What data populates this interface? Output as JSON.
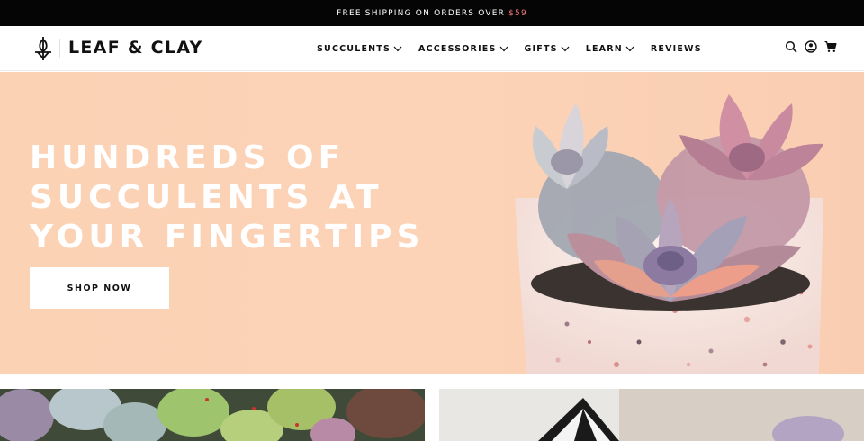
{
  "announcement": {
    "text": "FREE SHIPPING ON ORDERS OVER",
    "amount": "$59",
    "amount_color": "#f27777"
  },
  "brand": {
    "name": "LEAF & CLAY",
    "logo_icon": "plant-sprout-icon"
  },
  "nav": {
    "items": [
      {
        "label": "SUCCULENTS",
        "dropdown": true
      },
      {
        "label": "ACCESSORIES",
        "dropdown": true
      },
      {
        "label": "GIFTS",
        "dropdown": true
      },
      {
        "label": "LEARN",
        "dropdown": true
      },
      {
        "label": "REVIEWS",
        "dropdown": false
      }
    ]
  },
  "header_icons": [
    "search-icon",
    "account-icon",
    "cart-icon"
  ],
  "hero": {
    "heading": "HUNDREDS OF SUCCULENTS AT YOUR FINGERTIPS",
    "cta_label": "SHOP NOW",
    "background_color": "#fbd2b4"
  }
}
